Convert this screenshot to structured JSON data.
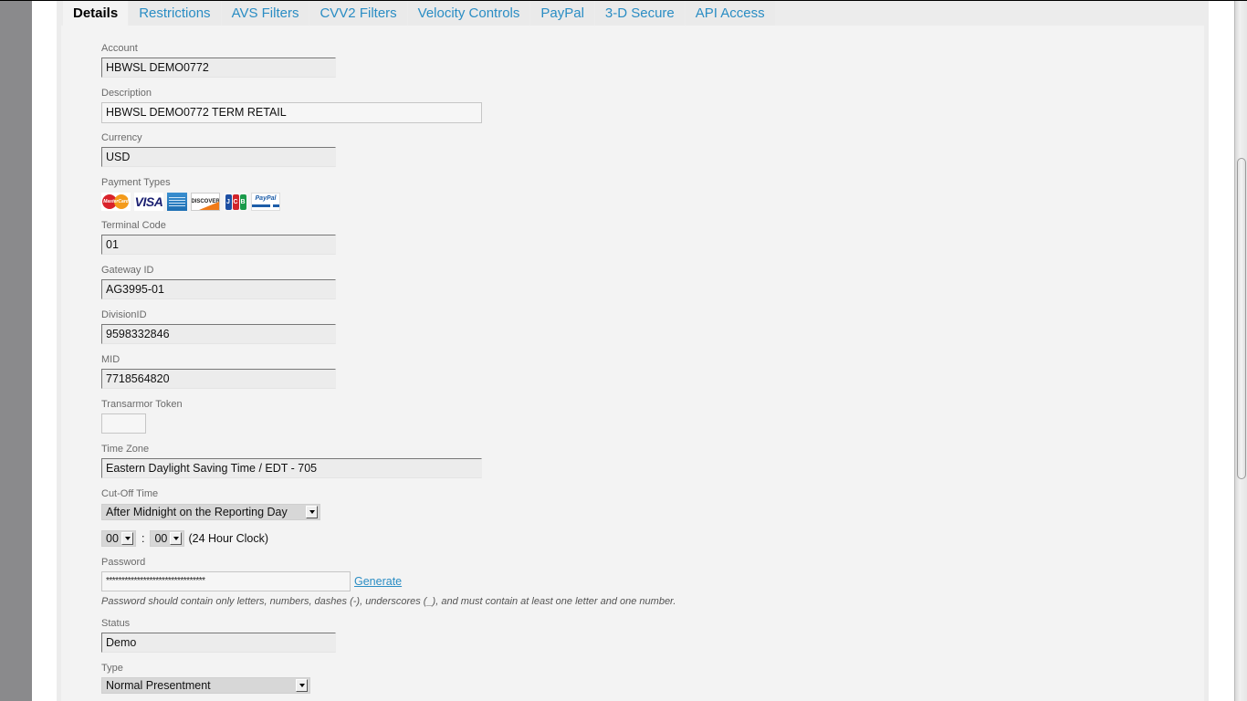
{
  "tabs": [
    {
      "label": "Details",
      "active": true
    },
    {
      "label": "Restrictions",
      "active": false
    },
    {
      "label": "AVS Filters",
      "active": false
    },
    {
      "label": "CVV2 Filters",
      "active": false
    },
    {
      "label": "Velocity Controls",
      "active": false
    },
    {
      "label": "PayPal",
      "active": false
    },
    {
      "label": "3-D Secure",
      "active": false
    },
    {
      "label": "API Access",
      "active": false
    }
  ],
  "details": {
    "account": {
      "label": "Account",
      "value": "HBWSL DEMO0772"
    },
    "description": {
      "label": "Description",
      "value": "HBWSL DEMO0772 TERM RETAIL"
    },
    "currency": {
      "label": "Currency",
      "value": "USD"
    },
    "payment_types": {
      "label": "Payment Types",
      "icons": [
        {
          "name": "mastercard-icon",
          "text": "MasterCard"
        },
        {
          "name": "visa-icon",
          "text": "VISA"
        },
        {
          "name": "amex-icon",
          "text": "American Express"
        },
        {
          "name": "discover-icon",
          "text": "DISCOVER"
        },
        {
          "name": "jcb-icon",
          "text": "JCB"
        },
        {
          "name": "paypal-icon",
          "text": "PayPal"
        }
      ]
    },
    "terminal_code": {
      "label": "Terminal Code",
      "value": "01"
    },
    "gateway_id": {
      "label": "Gateway ID",
      "value": "AG3995-01"
    },
    "division_id": {
      "label": "DivisionID",
      "value": "9598332846"
    },
    "mid": {
      "label": "MID",
      "value": "7718564820"
    },
    "transarmor_token": {
      "label": "Transarmor Token",
      "value": ""
    },
    "time_zone": {
      "label": "Time Zone",
      "value": "Eastern Daylight Saving Time / EDT - 705"
    },
    "cutoff_time": {
      "label": "Cut-Off Time",
      "selected": "After Midnight on the Reporting Day",
      "hour": "00",
      "minute": "00",
      "separator": ":",
      "clock_label": "(24 Hour Clock)"
    },
    "password": {
      "label": "Password",
      "value": "********************************",
      "generate_label": "Generate",
      "hint": "Password should contain only letters, numbers, dashes (-), underscores (_), and must contain at least one letter and one number."
    },
    "status": {
      "label": "Status",
      "value": "Demo"
    },
    "type": {
      "label": "Type",
      "selected": "Normal Presentment"
    }
  },
  "colors": {
    "link": "#2a8dc4",
    "active_tab_text": "#000000",
    "panel_bg": "#f3f3f3",
    "gutter": "#8a8a8c"
  }
}
